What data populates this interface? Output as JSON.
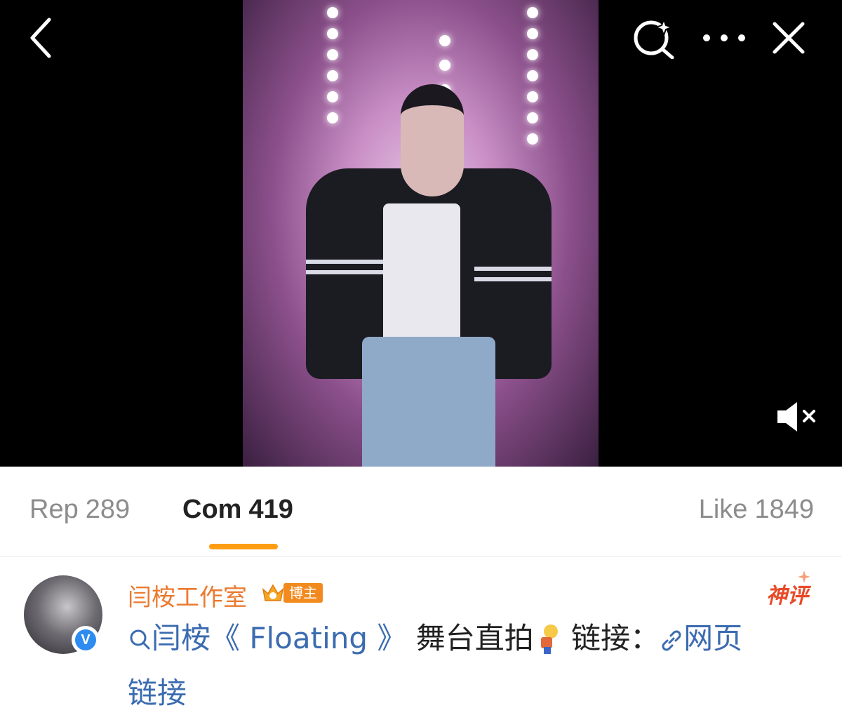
{
  "video": {
    "icons": {
      "back": "chevron-left-icon",
      "search": "sparkle-search-icon",
      "more": "more-dots-icon",
      "close": "close-icon",
      "mute": "muted-speaker-icon"
    }
  },
  "tabs": [
    {
      "label": "Rep",
      "count": "289",
      "active": false
    },
    {
      "label": "Com",
      "count": "419",
      "active": true
    },
    {
      "label": "Like",
      "count": "1849",
      "active": false
    }
  ],
  "colors": {
    "accent": "#ff9e14",
    "username": "#eb7a2f",
    "link": "#3b6bb0",
    "badge": "#f28a1f",
    "verified": "#2e8bf0"
  },
  "comment": {
    "author": "闫桉工作室",
    "badge_label": "博主",
    "verified_mark": "V",
    "hot_tag": "神评",
    "topic": "闫桉《 Floating 》",
    "text_after_topic": " 舞台直拍",
    "text_before_link": " 链接：",
    "link_part1": "网页",
    "link_part2": "链接"
  }
}
